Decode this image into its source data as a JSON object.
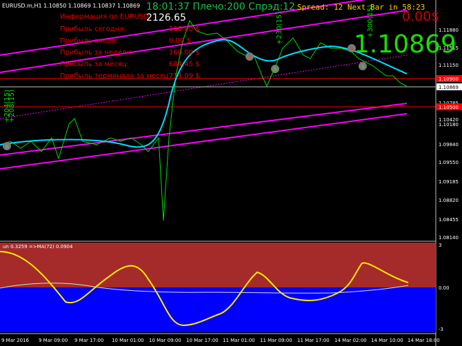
{
  "header": {
    "symbol_line": "EURUSD.m,H1  1.10850 1.10869 1.10837 1.10869",
    "clock_line": "18:01:37 Плечо:200 Спрэд:12",
    "balance_value": "2126.65",
    "spread_line": "Spread: 12  Next Bar in 58:23",
    "pnl_display": "0.00$",
    "big_price": "1.10869"
  },
  "info_panel": {
    "rows": [
      {
        "label": "Информация по EURUSD",
        "value": ""
      },
      {
        "label": "Прибыль сегодня:",
        "value": "150.00 $"
      },
      {
        "label": "Прибыль вчера:",
        "value": "0.00 $"
      },
      {
        "label": "Прибыль за неделю:",
        "value": "160.00 $"
      },
      {
        "label": "Прибыль за месяц:",
        "value": "684.45 $"
      },
      {
        "label": "Прибыль терминала за месяц:",
        "value": "714.09 $"
      }
    ]
  },
  "price_scale": {
    "ticks": [
      "1.11880",
      "1.11515",
      "1.11150",
      "1.10785",
      "1.10420",
      "1.10180",
      "1.09840",
      "1.09550",
      "1.09185",
      "1.08820",
      "1.08455",
      "1.08140"
    ],
    "markers": [
      {
        "label": "1.10869",
        "color": "#ffffff"
      },
      {
        "label": "1.10900",
        "color": "#ff0000"
      },
      {
        "label": "1.10500",
        "color": "#ff0000"
      }
    ]
  },
  "oscillator": {
    "label": "un 0.3259  =>MA(72) 0.0904",
    "ticks": [
      "3",
      "0.00",
      "-3"
    ]
  },
  "time_axis": {
    "labels": [
      "9 Mar 2016",
      "9 Mar 09:00",
      "9 Mar 17:00",
      "10 Mar 01:00",
      "10 Mar 09:00",
      "10 Mar 17:00",
      "11 Mar 01:00",
      "11 Mar 09:00",
      "11 Mar 17:00",
      "14 Mar 02:00",
      "14 Mar 10:00",
      "14 Mar 18:00"
    ]
  },
  "annotations": {
    "trade_labels": [
      "+230(15)",
      "+300(15)",
      "+204(15)",
      "+208(15)"
    ],
    "markers": [
      "4",
      "5",
      "5",
      "4",
      "4"
    ]
  },
  "colors": {
    "background": "#000000",
    "price_line": "#00e000",
    "smooth_line": "#00e0ff",
    "channel": "#ff00ff",
    "info_text": "#e00000",
    "osc_pos": "#b03030",
    "osc_neg": "#0000ff",
    "osc_line": "#ffee00"
  }
}
